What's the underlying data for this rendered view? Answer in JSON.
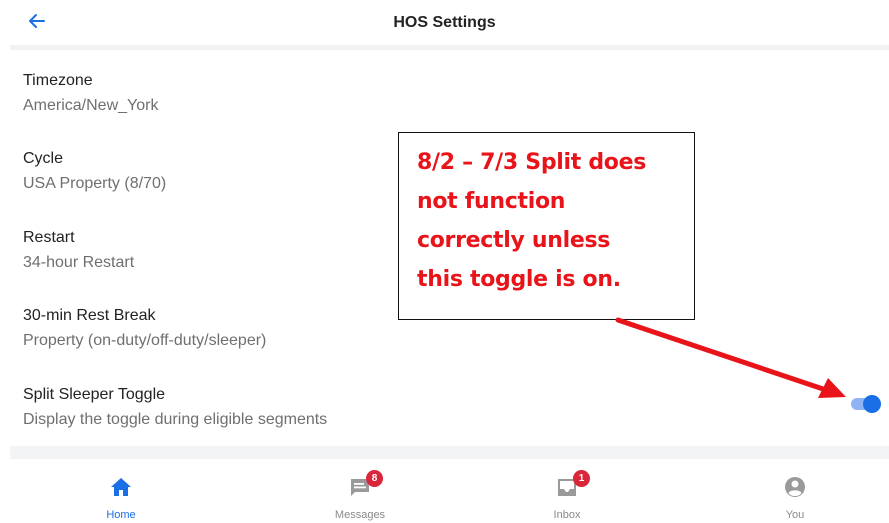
{
  "header": {
    "title": "HOS Settings",
    "back_icon": "arrow-left-icon"
  },
  "settings": [
    {
      "label": "Timezone",
      "value": "America/New_York"
    },
    {
      "label": "Cycle",
      "value": "USA Property (8/70)"
    },
    {
      "label": "Restart",
      "value": "34-hour Restart"
    },
    {
      "label": "30-min Rest Break",
      "value": "Property (on-duty/off-duty/sleeper)"
    },
    {
      "label": "Split Sleeper Toggle",
      "value": "Display the toggle during eligible segments",
      "toggle_on": true
    }
  ],
  "bottom_nav": [
    {
      "label": "Home",
      "icon": "home-icon",
      "active": true
    },
    {
      "label": "Messages",
      "icon": "messages-icon",
      "badge": "8"
    },
    {
      "label": "Inbox",
      "icon": "inbox-icon",
      "badge": "1"
    },
    {
      "label": "You",
      "icon": "user-icon"
    }
  ],
  "annotation": {
    "lines": [
      "8/2 – 7/3 Split does",
      "not function",
      "correctly unless",
      "this toggle is on."
    ]
  },
  "colors": {
    "accent": "#1a6fe6",
    "badge": "#d9263a",
    "annotation": "#e8141a"
  }
}
